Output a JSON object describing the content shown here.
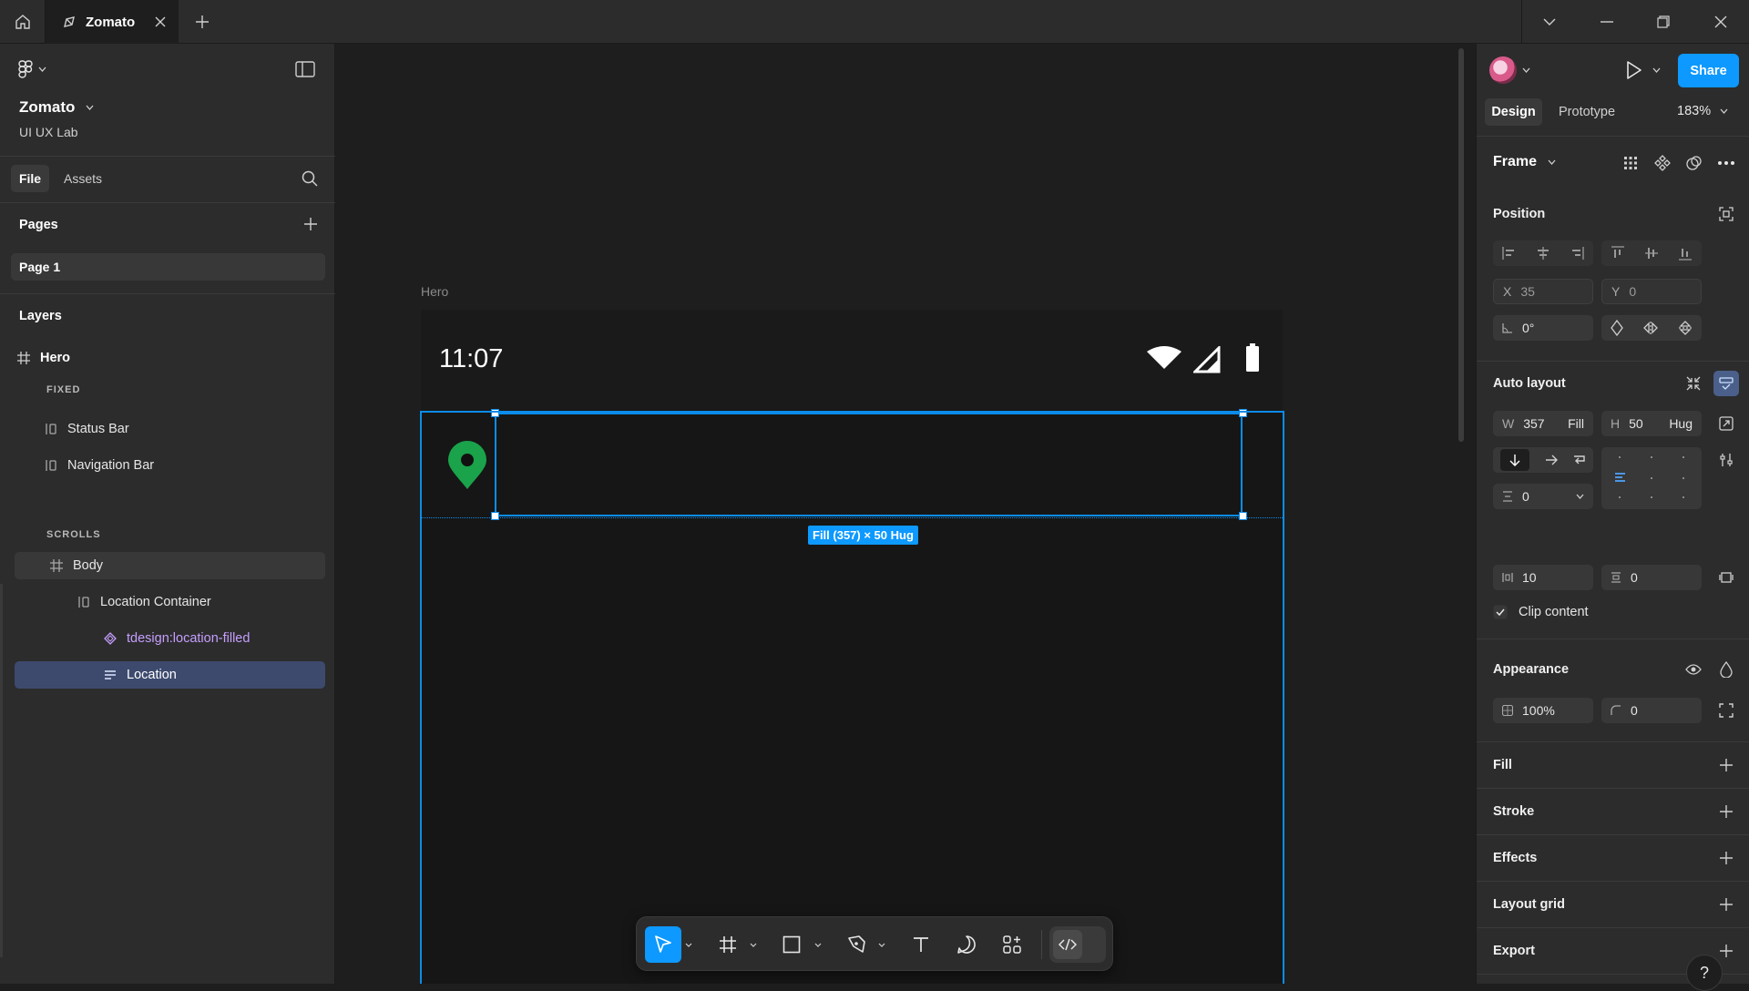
{
  "app": {
    "tab_title": "Zomato",
    "colors": {
      "accent": "#0d99ff",
      "selection": "#0c8ce9",
      "component": "#c69fff",
      "pin": "#1aa34a",
      "layer_selected": "#3d4a6e"
    }
  },
  "left_panel": {
    "file_name": "Zomato",
    "team_name": "UI UX Lab",
    "tabs": {
      "file": "File",
      "assets": "Assets"
    },
    "pages_title": "Pages",
    "pages": [
      "Page 1"
    ],
    "layers_title": "Layers",
    "layers": {
      "hero": "Hero",
      "fixed_label": "FIXED",
      "status_bar": "Status Bar",
      "navigation_bar": "Navigation Bar",
      "scrolls_label": "SCROLLS",
      "body": "Body",
      "location_container": "Location Container",
      "location_icon": "tdesign:location-filled",
      "location": "Location"
    }
  },
  "canvas": {
    "frame_label": "Hero",
    "status_time": "11:07",
    "selection_badge": "Fill (357) × 50 Hug"
  },
  "right_panel": {
    "share_label": "Share",
    "tabs": {
      "design": "Design",
      "prototype": "Prototype"
    },
    "zoom": "183%",
    "frame_type": "Frame",
    "position": {
      "title": "Position",
      "x_label": "X",
      "x_value": "35",
      "y_label": "Y",
      "y_value": "0",
      "rotation": "0°"
    },
    "auto_layout": {
      "title": "Auto layout",
      "w_label": "W",
      "w_value": "357",
      "w_mode": "Fill",
      "h_label": "H",
      "h_value": "50",
      "h_mode": "Hug",
      "gap": "0",
      "padding_h": "10",
      "padding_v": "0",
      "clip_content": "Clip content"
    },
    "appearance": {
      "title": "Appearance",
      "opacity": "100%",
      "radius": "0"
    },
    "sections": [
      "Fill",
      "Stroke",
      "Effects",
      "Layout grid",
      "Export"
    ]
  },
  "help_label": "?"
}
